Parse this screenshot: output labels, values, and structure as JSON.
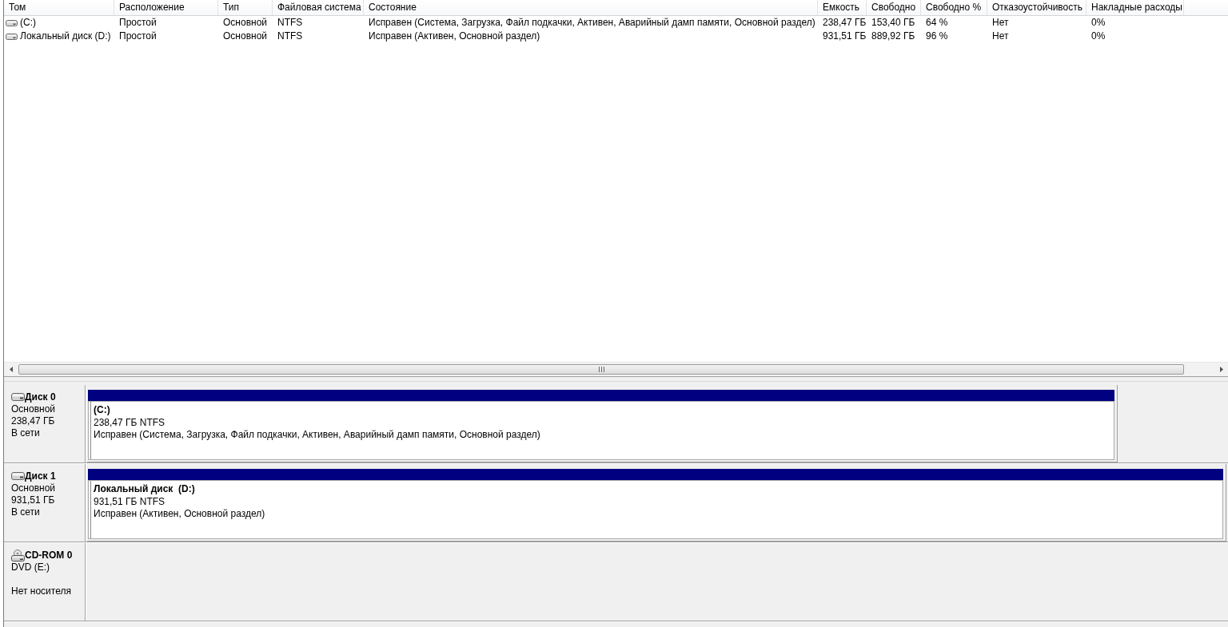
{
  "volume_list": {
    "columns": [
      "Том",
      "Расположение",
      "Тип",
      "Файловая система",
      "Состояние",
      "Емкость",
      "Свободно",
      "Свободно %",
      "Отказоустойчивость",
      "Накладные расходы"
    ],
    "rows": [
      [
        "(C:)",
        "Простой",
        "Основной",
        "NTFS",
        "Исправен (Система, Загрузка, Файл подкачки, Активен, Аварийный дамп памяти, Основной раздел)",
        "238,47 ГБ",
        "153,40 ГБ",
        "64 %",
        "Нет",
        "0%"
      ],
      [
        "Локальный диск (D:)",
        "Простой",
        "Основной",
        "NTFS",
        "Исправен (Активен, Основной раздел)",
        "931,51 ГБ",
        "889,92 ГБ",
        "96 %",
        "Нет",
        "0%"
      ]
    ]
  },
  "disks": [
    {
      "kind": "disk",
      "name": "Диск 0",
      "type": "Основной",
      "size": "238,47 ГБ",
      "status": "В сети",
      "partitions": [
        {
          "title": "(C:)",
          "size": "238,47 ГБ NTFS",
          "status": "Исправен (Система, Загрузка, Файл подкачки, Активен, Аварийный дамп памяти, Основной раздел)"
        }
      ]
    },
    {
      "kind": "disk",
      "name": "Диск 1",
      "type": "Основной",
      "size": "931,51 ГБ",
      "status": "В сети",
      "partitions": [
        {
          "title": "Локальный диск  (D:)",
          "size": "931,51 ГБ NTFS",
          "status": "Исправен (Активен, Основной раздел)"
        }
      ]
    },
    {
      "kind": "cdrom",
      "name": "CD-ROM 0",
      "drive": "DVD (E:)",
      "status": "Нет носителя"
    }
  ]
}
